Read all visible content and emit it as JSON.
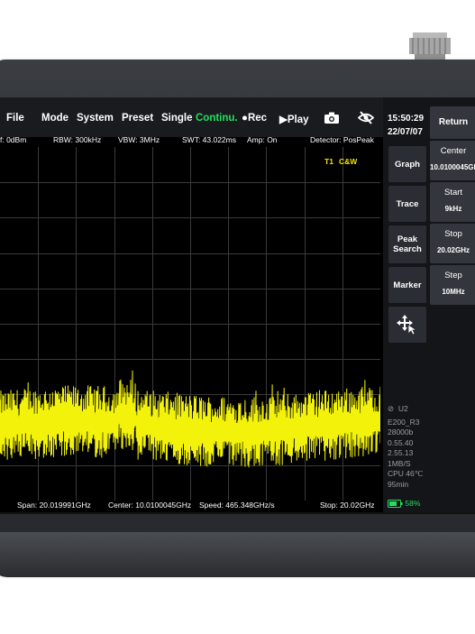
{
  "menu": {
    "file": "File",
    "mode": "Mode",
    "system": "System",
    "preset": "Preset",
    "single": "Single",
    "continuous": "Continu.",
    "rec": "Rec",
    "play": "Play"
  },
  "info": {
    "ref": "f: 0dBm",
    "rbw": "RBW: 300kHz",
    "vbw": "VBW: 3MHz",
    "swt": "SWT: 43.022ms",
    "amp": "Amp: On",
    "detector": "Detector: PosPeak"
  },
  "trace_label": {
    "t1": "T1",
    "mode": "C&W"
  },
  "bottom": {
    "span": "Span: 20.019991GHz",
    "center": "Center: 10.0100045GHz",
    "speed": "Speed: 465.348GHz/s",
    "stop": "Stop: 20.02GHz"
  },
  "clock": {
    "time": "15:50:29",
    "date": "22/07/07"
  },
  "side_buttons": {
    "graph": "Graph",
    "trace": "Trace",
    "peak_search_1": "Peak",
    "peak_search_2": "Search",
    "marker": "Marker"
  },
  "params": {
    "return": "Return",
    "center_label": "Center",
    "center_value": "10.0100045GHz",
    "start_label": "Start",
    "start_value": "9kHz",
    "stop_label": "Stop",
    "stop_value": "20.02GHz",
    "step_label": "Step",
    "step_value": "10MHz"
  },
  "status": {
    "user": "U2",
    "lines": [
      "E200_R3",
      "28000b",
      "0.55.40",
      "2.55.13",
      "1MB/S",
      "CPU 46℃",
      "95min"
    ],
    "battery": "58%"
  },
  "colors": {
    "trace": "#f2f20a",
    "accent_green": "#1fe060",
    "label_yellow": "#f5e400"
  }
}
